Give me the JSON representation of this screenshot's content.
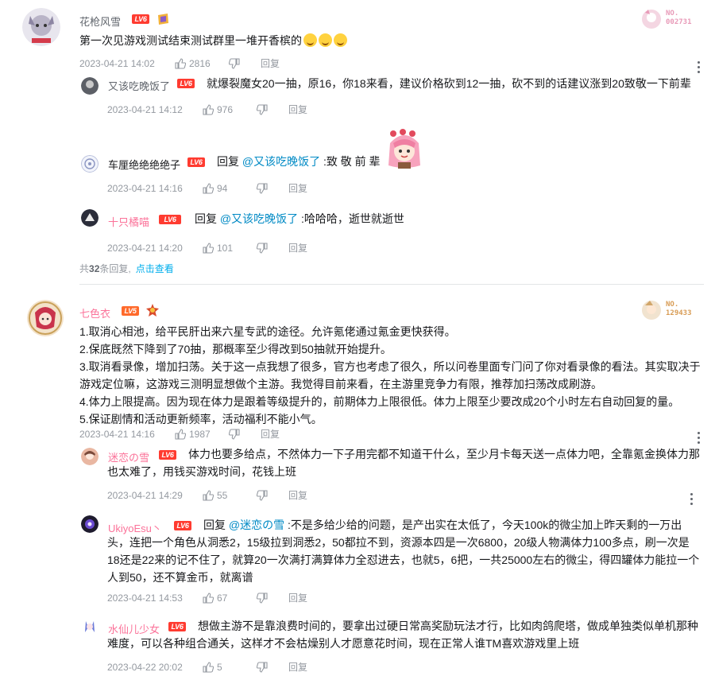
{
  "comments": [
    {
      "user": "花枪风雪",
      "level": "LV6",
      "fan_no": "NO.\n002731",
      "text": "第一次见游戏测试结束测试群里一堆开香槟的",
      "emojis": [
        "laugh-cry-emoji",
        "laugh-cry-emoji",
        "laugh-cry-emoji"
      ],
      "date": "2023-04-21 14:02",
      "likes": "2816",
      "reply_label": "回复",
      "replies": [
        {
          "user": "又该吃晚饭了",
          "level": "LV6",
          "text": "就爆裂魔女20一抽，原16，你18来看，建议价格砍到12一抽，砍不到的话建议涨到20致敬一下前辈",
          "date": "2023-04-21 14:12",
          "likes": "976",
          "reply_label": "回复"
        },
        {
          "user": "车厘绝绝绝绝子",
          "level": "LV6",
          "prefix": "回复",
          "at": "@又该吃晚饭了",
          "text": " :致 敬 前 辈",
          "date": "2023-04-21 14:16",
          "likes": "94",
          "reply_label": "回复"
        },
        {
          "user": "十只橘喵",
          "level": "LV6",
          "prefix": "回复",
          "at": "@又该吃晚饭了",
          "text": " :哈哈哈，逝世就逝世",
          "date": "2023-04-21 14:20",
          "likes": "101",
          "reply_label": "回复"
        }
      ],
      "total_prefix": "共",
      "total_count": "32",
      "total_suffix": "条回复,",
      "total_link": "点击查看"
    },
    {
      "user": "七色衣",
      "level": "LV5",
      "fan_no": "NO.\n129433",
      "lines": [
        "1.取消心相池，给平民肝出来六星专武的途径。允许氪佬通过氪金更快获得。",
        "2.保底既然下降到了70抽，那概率至少得改到50抽就开始提升。",
        "3.取消看录像，增加扫荡。关于这一点我想了很多，官方也考虑了很久，所以问卷里面专门问了你对看录像的看法。其实取决于",
        "游戏定位嘛，这游戏三测明显想做个主游。我觉得目前来看，在主游里竞争力有限，推荐加扫荡改成刷游。",
        "4.体力上限提高。因为现在体力是跟着等级提升的，前期体力上限很低。体力上限至少要改成20个小时左右自动回复的量。",
        "5.保证剧情和活动更新频率，活动福利不能小气。"
      ],
      "date": "2023-04-21 14:16",
      "likes": "1987",
      "reply_label": "回复",
      "replies": [
        {
          "user": "迷恋の雪",
          "level": "LV6",
          "lines": [
            "体力也要多给点，不然体力一下子用完都不知道干什么，至少月卡每天送一点体力吧，全靠氪金换体力那",
            "也太难了，用钱买游戏时间，花钱上班"
          ],
          "date": "2023-04-21 14:29",
          "likes": "55",
          "reply_label": "回复"
        },
        {
          "user": "UkiyoEsu丶",
          "level": "LV6",
          "prefix": "回复",
          "at": "@迷恋の雪",
          "lines": [
            " :不是多给少给的问题，是产出实在太低了，今天100k的微尘加上昨天剩的一万出",
            "头，连把一个角色从洞悉2，15级拉到洞悉2，50都拉不到，资源本四是一次6800，20级人物满体力100多点，刷一次是",
            "18还是22来的记不住了，就算20一次满打满算体力全怼进去，也就5，6把，一共25000左右的微尘，得四罐体力能拉一个",
            "人到50，还不算金币，就离谱"
          ],
          "date": "2023-04-21 14:53",
          "likes": "67",
          "reply_label": "回复"
        },
        {
          "user": "水仙儿少女",
          "level": "LV6",
          "lines": [
            "想做主游不是靠浪费时间的，要拿出过硬日常高奖励玩法才行，比如肉鸽爬塔，做成单独类似单机那种",
            "难度，可以各种组合通关，这样才不会枯燥别人才愿意花时间，现在正常人谁TM喜欢游戏里上班"
          ],
          "date": "2023-04-22 20:02",
          "likes": "5",
          "reply_label": "回复"
        }
      ]
    }
  ]
}
